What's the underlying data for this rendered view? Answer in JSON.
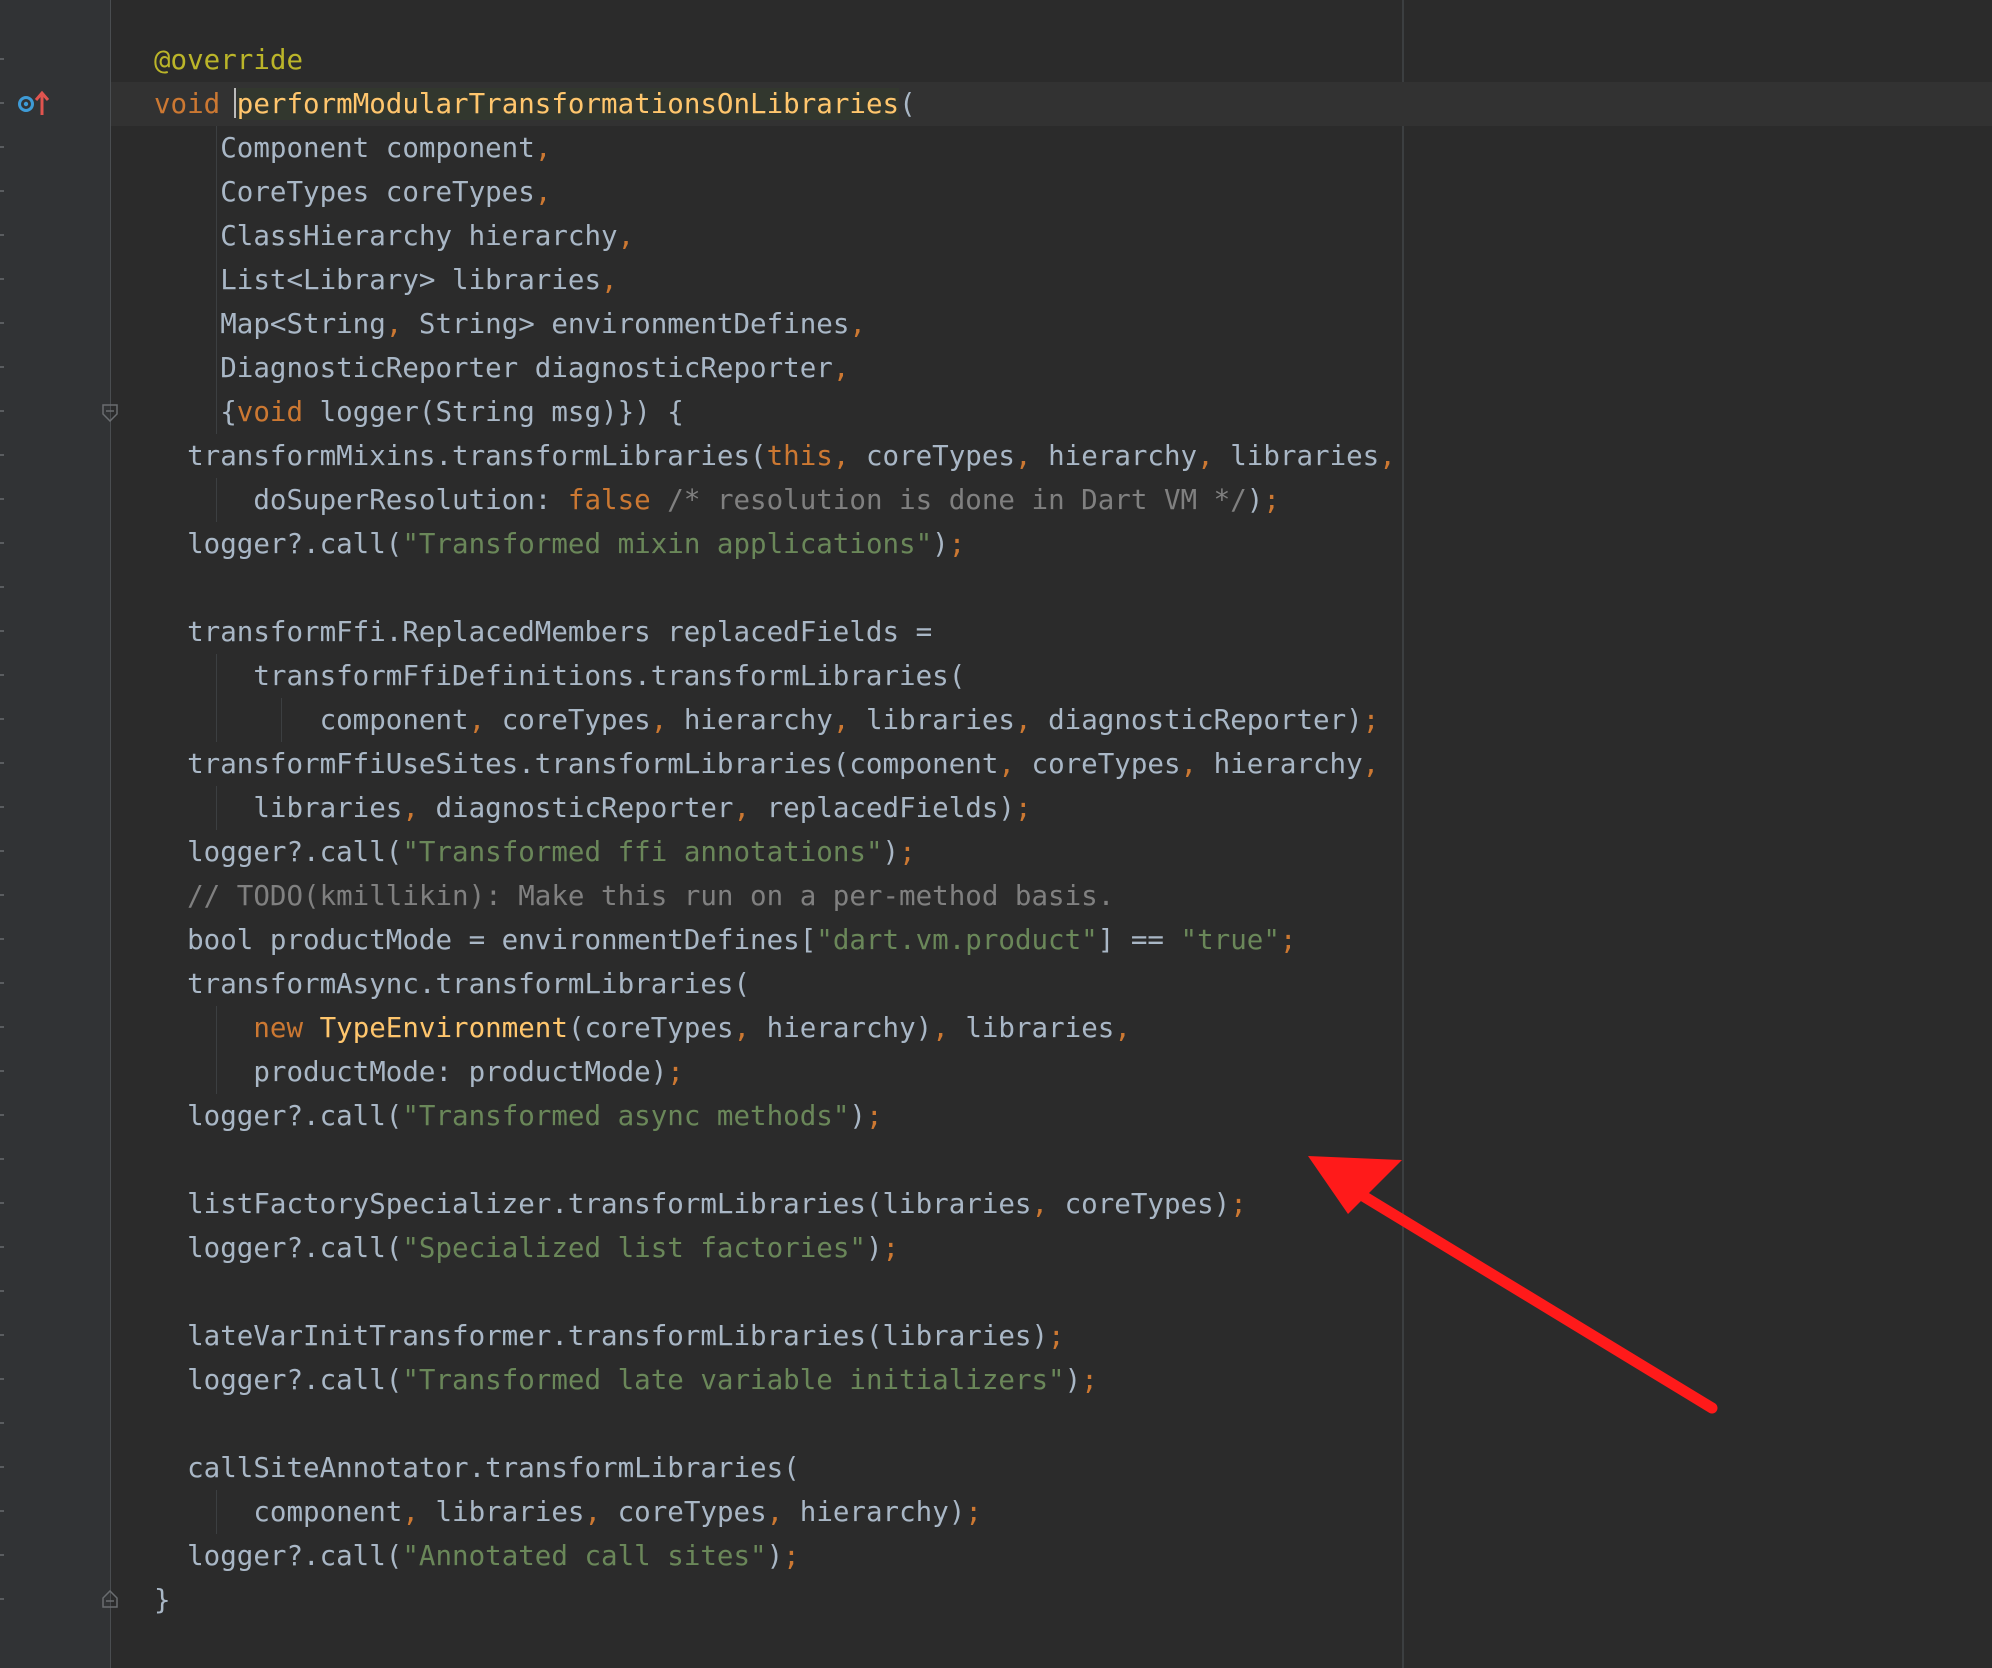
{
  "editor": {
    "language": "Dart",
    "annotation_arrow_color": "#ff1a1a",
    "gutter": {
      "markers": [
        {
          "icon": "implementing-method-icon",
          "line": 2
        },
        {
          "icon": "fold-start-icon",
          "line": 9
        },
        {
          "icon": "fold-end-icon",
          "line": 36
        }
      ]
    },
    "lines": [
      [
        {
          "t": "@override",
          "c": "anno"
        }
      ],
      [
        {
          "t": "void ",
          "c": "kw"
        },
        {
          "t": "performModularTransformationsOnLibraries",
          "c": "fn-decl"
        },
        {
          "t": "(",
          "c": "plain"
        }
      ],
      [
        {
          "t": "    Component component",
          "c": "plain"
        },
        {
          "t": ",",
          "c": "punct"
        }
      ],
      [
        {
          "t": "    CoreTypes coreTypes",
          "c": "plain"
        },
        {
          "t": ",",
          "c": "punct"
        }
      ],
      [
        {
          "t": "    ClassHierarchy hierarchy",
          "c": "plain"
        },
        {
          "t": ",",
          "c": "punct"
        }
      ],
      [
        {
          "t": "    List<Library> libraries",
          "c": "plain"
        },
        {
          "t": ",",
          "c": "punct"
        }
      ],
      [
        {
          "t": "    Map<String",
          "c": "plain"
        },
        {
          "t": ",",
          "c": "punct"
        },
        {
          "t": " String> environmentDefines",
          "c": "plain"
        },
        {
          "t": ",",
          "c": "punct"
        }
      ],
      [
        {
          "t": "    DiagnosticReporter diagnosticReporter",
          "c": "plain"
        },
        {
          "t": ",",
          "c": "punct"
        }
      ],
      [
        {
          "t": "    {",
          "c": "plain"
        },
        {
          "t": "void",
          "c": "kw"
        },
        {
          "t": " logger(String msg)}) {",
          "c": "plain"
        }
      ],
      [
        {
          "t": "  transformMixins.transformLibraries(",
          "c": "plain"
        },
        {
          "t": "this",
          "c": "kw"
        },
        {
          "t": ",",
          "c": "punct"
        },
        {
          "t": " coreTypes",
          "c": "plain"
        },
        {
          "t": ",",
          "c": "punct"
        },
        {
          "t": " hierarchy",
          "c": "plain"
        },
        {
          "t": ",",
          "c": "punct"
        },
        {
          "t": " libraries",
          "c": "plain"
        },
        {
          "t": ",",
          "c": "punct"
        }
      ],
      [
        {
          "t": "      doSuperResolution: ",
          "c": "plain"
        },
        {
          "t": "false",
          "c": "kw"
        },
        {
          "t": " /* resolution is done in Dart VM */",
          "c": "comment"
        },
        {
          "t": ")",
          "c": "plain"
        },
        {
          "t": ";",
          "c": "punct"
        }
      ],
      [
        {
          "t": "  logger?.call(",
          "c": "plain"
        },
        {
          "t": "\"Transformed mixin applications\"",
          "c": "str"
        },
        {
          "t": ")",
          "c": "plain"
        },
        {
          "t": ";",
          "c": "punct"
        }
      ],
      [],
      [
        {
          "t": "  transformFfi.ReplacedMembers replacedFields =",
          "c": "plain"
        }
      ],
      [
        {
          "t": "      transformFfiDefinitions.transformLibraries(",
          "c": "plain"
        }
      ],
      [
        {
          "t": "          component",
          "c": "plain"
        },
        {
          "t": ",",
          "c": "punct"
        },
        {
          "t": " coreTypes",
          "c": "plain"
        },
        {
          "t": ",",
          "c": "punct"
        },
        {
          "t": " hierarchy",
          "c": "plain"
        },
        {
          "t": ",",
          "c": "punct"
        },
        {
          "t": " libraries",
          "c": "plain"
        },
        {
          "t": ",",
          "c": "punct"
        },
        {
          "t": " diagnosticReporter)",
          "c": "plain"
        },
        {
          "t": ";",
          "c": "punct"
        }
      ],
      [
        {
          "t": "  transformFfiUseSites.transformLibraries(component",
          "c": "plain"
        },
        {
          "t": ",",
          "c": "punct"
        },
        {
          "t": " coreTypes",
          "c": "plain"
        },
        {
          "t": ",",
          "c": "punct"
        },
        {
          "t": " hierarchy",
          "c": "plain"
        },
        {
          "t": ",",
          "c": "punct"
        }
      ],
      [
        {
          "t": "      libraries",
          "c": "plain"
        },
        {
          "t": ",",
          "c": "punct"
        },
        {
          "t": " diagnosticReporter",
          "c": "plain"
        },
        {
          "t": ",",
          "c": "punct"
        },
        {
          "t": " replacedFields)",
          "c": "plain"
        },
        {
          "t": ";",
          "c": "punct"
        }
      ],
      [
        {
          "t": "  logger?.call(",
          "c": "plain"
        },
        {
          "t": "\"Transformed ffi annotations\"",
          "c": "str"
        },
        {
          "t": ")",
          "c": "plain"
        },
        {
          "t": ";",
          "c": "punct"
        }
      ],
      [
        {
          "t": "  // TODO(kmillikin): Make this run on a per-method basis.",
          "c": "comment"
        }
      ],
      [
        {
          "t": "  bool productMode = environmentDefines[",
          "c": "plain"
        },
        {
          "t": "\"dart.vm.product\"",
          "c": "str"
        },
        {
          "t": "] == ",
          "c": "plain"
        },
        {
          "t": "\"true\"",
          "c": "str"
        },
        {
          "t": ";",
          "c": "punct"
        }
      ],
      [
        {
          "t": "  transformAsync.transformLibraries(",
          "c": "plain"
        }
      ],
      [
        {
          "t": "      ",
          "c": "plain"
        },
        {
          "t": "new",
          "c": "kw"
        },
        {
          "t": " ",
          "c": "plain"
        },
        {
          "t": "TypeEnvironment",
          "c": "fn"
        },
        {
          "t": "(coreTypes",
          "c": "plain"
        },
        {
          "t": ",",
          "c": "punct"
        },
        {
          "t": " hierarchy)",
          "c": "plain"
        },
        {
          "t": ",",
          "c": "punct"
        },
        {
          "t": " libraries",
          "c": "plain"
        },
        {
          "t": ",",
          "c": "punct"
        }
      ],
      [
        {
          "t": "      productMode: productMode)",
          "c": "plain"
        },
        {
          "t": ";",
          "c": "punct"
        }
      ],
      [
        {
          "t": "  logger?.call(",
          "c": "plain"
        },
        {
          "t": "\"Transformed async methods\"",
          "c": "str"
        },
        {
          "t": ")",
          "c": "plain"
        },
        {
          "t": ";",
          "c": "punct"
        }
      ],
      [],
      [
        {
          "t": "  listFactorySpecializer.transformLibraries(libraries",
          "c": "plain"
        },
        {
          "t": ",",
          "c": "punct"
        },
        {
          "t": " coreTypes)",
          "c": "plain"
        },
        {
          "t": ";",
          "c": "punct"
        }
      ],
      [
        {
          "t": "  logger?.call(",
          "c": "plain"
        },
        {
          "t": "\"Specialized list factories\"",
          "c": "str"
        },
        {
          "t": ")",
          "c": "plain"
        },
        {
          "t": ";",
          "c": "punct"
        }
      ],
      [],
      [
        {
          "t": "  lateVarInitTransformer.transformLibraries(libraries)",
          "c": "plain"
        },
        {
          "t": ";",
          "c": "punct"
        }
      ],
      [
        {
          "t": "  logger?.call(",
          "c": "plain"
        },
        {
          "t": "\"Transformed late variable initializers\"",
          "c": "str"
        },
        {
          "t": ")",
          "c": "plain"
        },
        {
          "t": ";",
          "c": "punct"
        }
      ],
      [],
      [
        {
          "t": "  callSiteAnnotator.transformLibraries(",
          "c": "plain"
        }
      ],
      [
        {
          "t": "      component",
          "c": "plain"
        },
        {
          "t": ",",
          "c": "punct"
        },
        {
          "t": " libraries",
          "c": "plain"
        },
        {
          "t": ",",
          "c": "punct"
        },
        {
          "t": " coreTypes",
          "c": "plain"
        },
        {
          "t": ",",
          "c": "punct"
        },
        {
          "t": " hierarchy)",
          "c": "plain"
        },
        {
          "t": ";",
          "c": "punct"
        }
      ],
      [
        {
          "t": "  logger?.call(",
          "c": "plain"
        },
        {
          "t": "\"Annotated call sites\"",
          "c": "str"
        },
        {
          "t": ")",
          "c": "plain"
        },
        {
          "t": ";",
          "c": "punct"
        }
      ],
      [
        {
          "t": "}",
          "c": "plain"
        }
      ]
    ]
  }
}
